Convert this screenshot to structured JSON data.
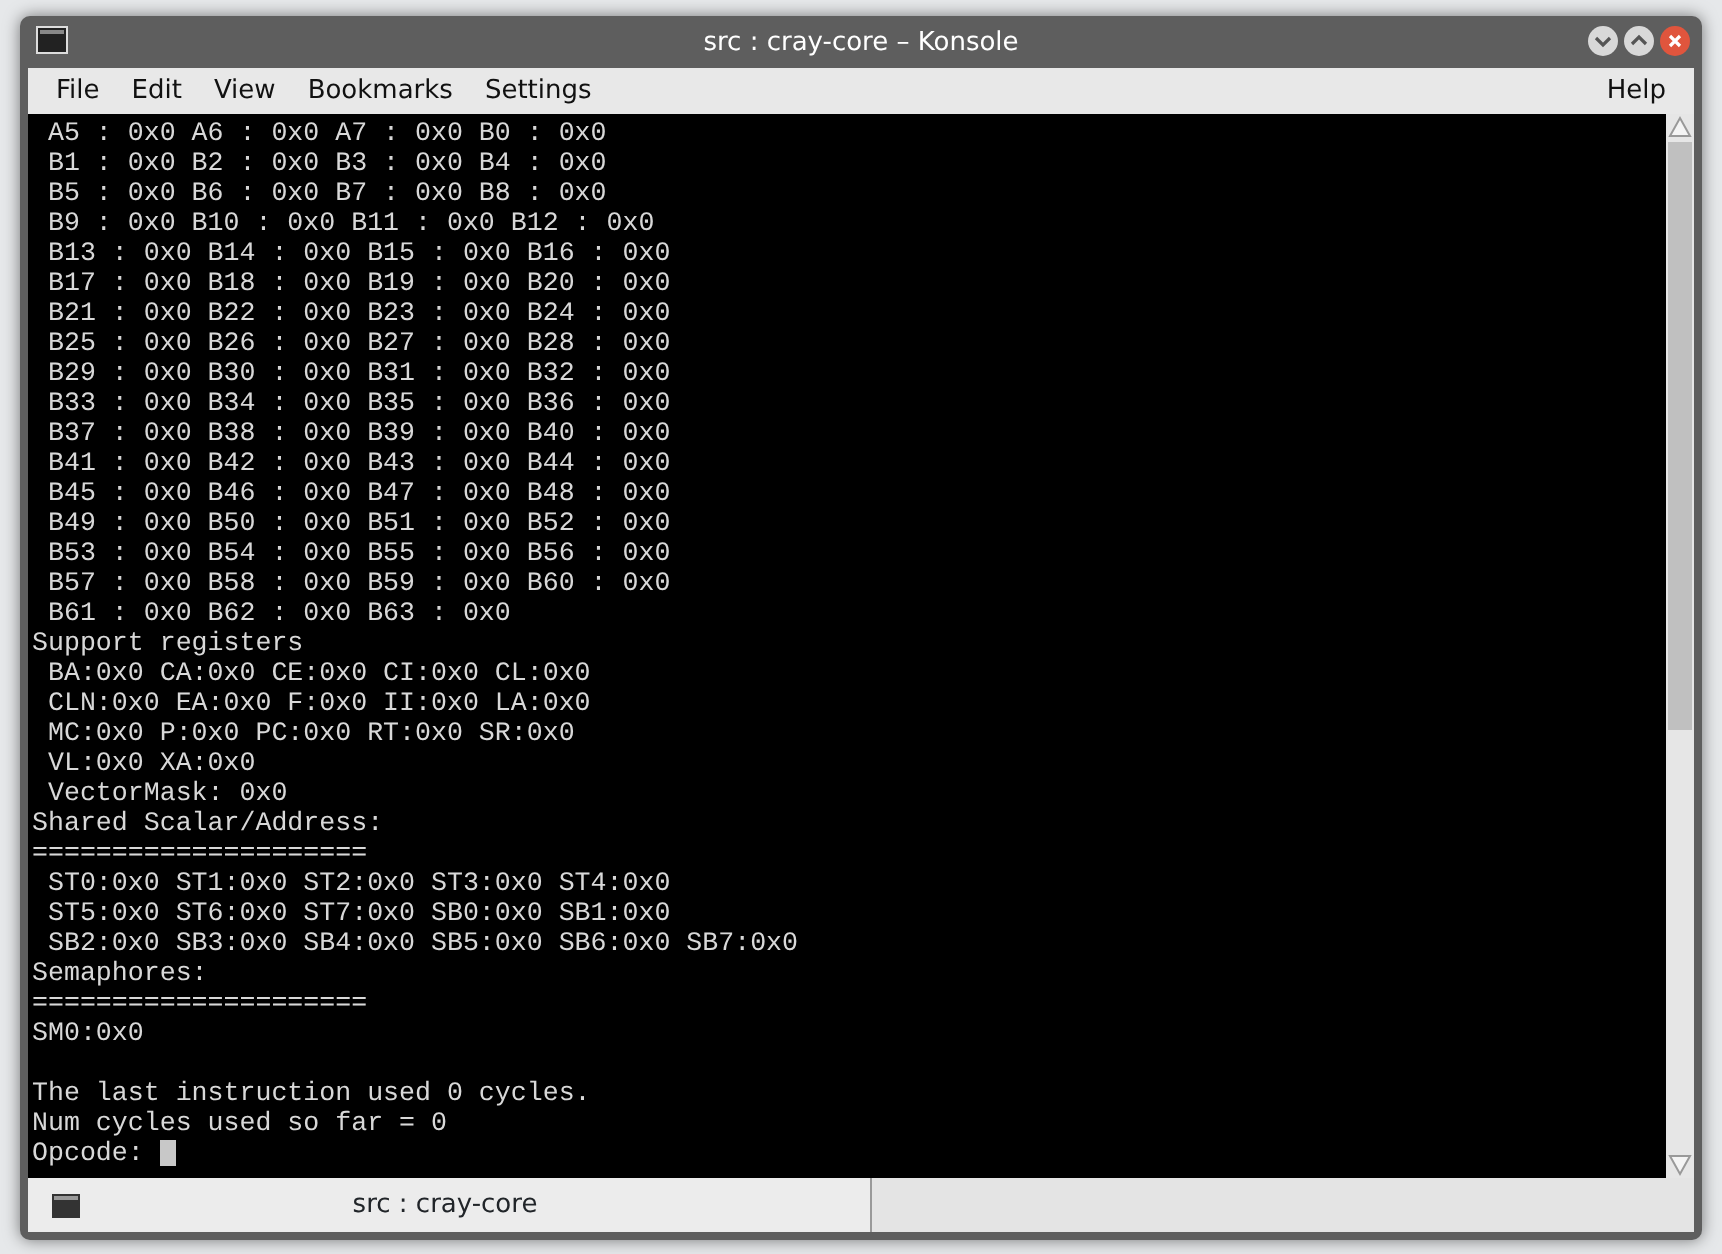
{
  "window": {
    "title": "src : cray-core – Konsole"
  },
  "menu": [
    {
      "label": "File"
    },
    {
      "label": "Edit"
    },
    {
      "label": "View"
    },
    {
      "label": "Bookmarks"
    },
    {
      "label": "Settings"
    }
  ],
  "help_menu": {
    "label": "Help"
  },
  "terminal": {
    "lines": [
      {
        "text": " A5 : 0x0 A6 : 0x0 A7 : 0x0 B0 : 0x0"
      },
      {
        "text": " B1 : 0x0 B2 : 0x0 B3 : 0x0 B4 : 0x0"
      },
      {
        "text": " B5 : 0x0 B6 : 0x0 B7 : 0x0 B8 : 0x0"
      },
      {
        "text": " B9 : 0x0 B10 : 0x0 B11 : 0x0 B12 : 0x0"
      },
      {
        "text": " B13 : 0x0 B14 : 0x0 B15 : 0x0 B16 : 0x0"
      },
      {
        "text": " B17 : 0x0 B18 : 0x0 B19 : 0x0 B20 : 0x0"
      },
      {
        "text": " B21 : 0x0 B22 : 0x0 B23 : 0x0 B24 : 0x0"
      },
      {
        "text": " B25 : 0x0 B26 : 0x0 B27 : 0x0 B28 : 0x0"
      },
      {
        "text": " B29 : 0x0 B30 : 0x0 B31 : 0x0 B32 : 0x0"
      },
      {
        "text": " B33 : 0x0 B34 : 0x0 B35 : 0x0 B36 : 0x0"
      },
      {
        "text": " B37 : 0x0 B38 : 0x0 B39 : 0x0 B40 : 0x0"
      },
      {
        "text": " B41 : 0x0 B42 : 0x0 B43 : 0x0 B44 : 0x0"
      },
      {
        "text": " B45 : 0x0 B46 : 0x0 B47 : 0x0 B48 : 0x0"
      },
      {
        "text": " B49 : 0x0 B50 : 0x0 B51 : 0x0 B52 : 0x0"
      },
      {
        "text": " B53 : 0x0 B54 : 0x0 B55 : 0x0 B56 : 0x0"
      },
      {
        "text": " B57 : 0x0 B58 : 0x0 B59 : 0x0 B60 : 0x0"
      },
      {
        "text": " B61 : 0x0 B62 : 0x0 B63 : 0x0"
      },
      {
        "text": "Support registers"
      },
      {
        "text": " BA:0x0 CA:0x0 CE:0x0 CI:0x0 CL:0x0"
      },
      {
        "text": " CLN:0x0 EA:0x0 F:0x0 II:0x0 LA:0x0"
      },
      {
        "text": " MC:0x0 P:0x0 PC:0x0 RT:0x0 SR:0x0"
      },
      {
        "text": " VL:0x0 XA:0x0"
      },
      {
        "text": " VectorMask: 0x0"
      },
      {
        "text": "Shared Scalar/Address:"
      },
      {
        "text": "====================="
      },
      {
        "text": " ST0:0x0 ST1:0x0 ST2:0x0 ST3:0x0 ST4:0x0"
      },
      {
        "text": " ST5:0x0 ST6:0x0 ST7:0x0 SB0:0x0 SB1:0x0"
      },
      {
        "text": " SB2:0x0 SB3:0x0 SB4:0x0 SB5:0x0 SB6:0x0 SB7:0x0"
      },
      {
        "text": "Semaphores:"
      },
      {
        "text": "====================="
      },
      {
        "text": "SM0:0x0"
      },
      {
        "text": "The last instruction used 0 cycles.",
        "gap_before": true
      },
      {
        "text": "Num cycles used so far = 0"
      }
    ],
    "prompt": "Opcode:"
  },
  "tabs": [
    {
      "label": "src : cray-core",
      "selected": true
    }
  ]
}
